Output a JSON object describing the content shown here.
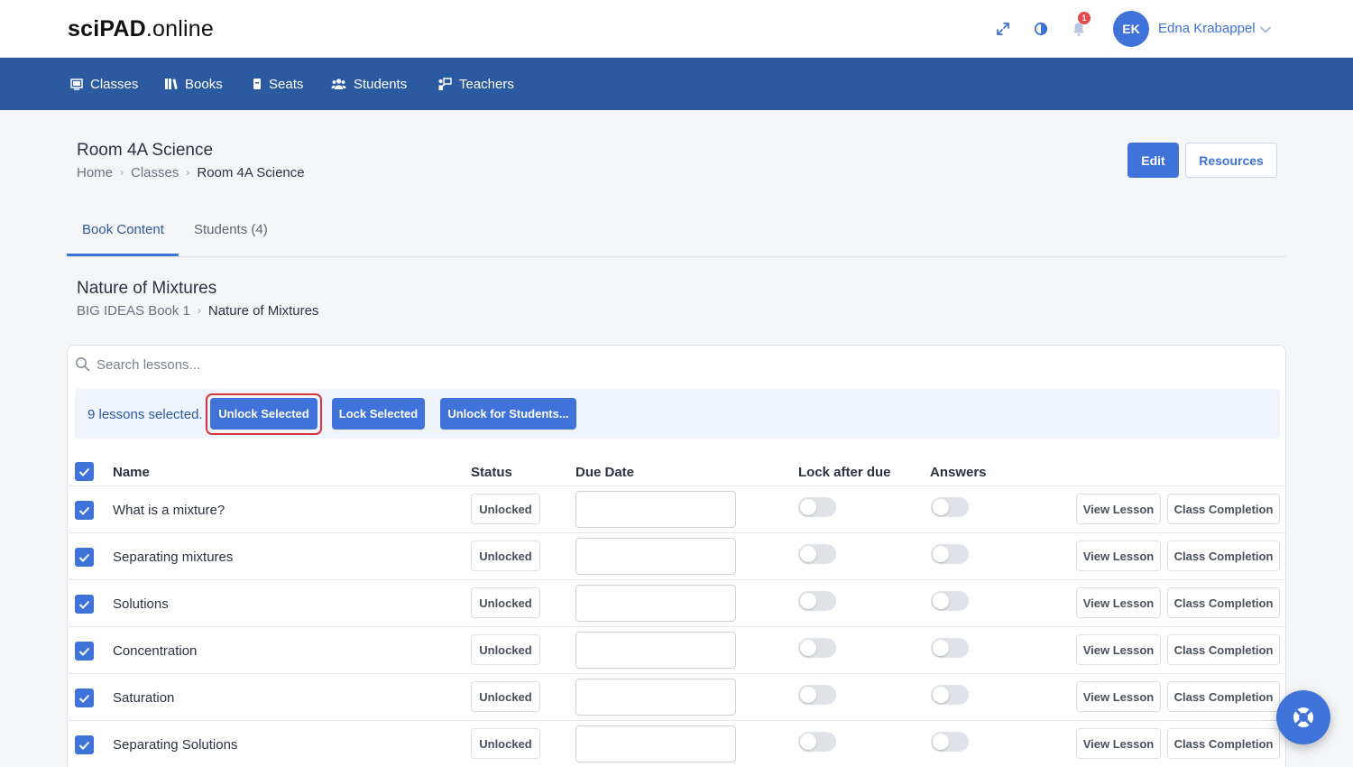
{
  "app": {
    "logo_bold": "sciPAD",
    "logo_light": ".online"
  },
  "user": {
    "initials": "EK",
    "name": "Edna Krabappel",
    "notification_count": "1"
  },
  "nav": {
    "items": [
      {
        "label": "Classes",
        "icon": "classroom-icon"
      },
      {
        "label": "Books",
        "icon": "books-icon"
      },
      {
        "label": "Seats",
        "icon": "seat-icon"
      },
      {
        "label": "Students",
        "icon": "students-icon"
      },
      {
        "label": "Teachers",
        "icon": "teachers-icon"
      }
    ]
  },
  "page": {
    "title": "Room 4A Science",
    "breadcrumb": [
      "Home",
      "Classes",
      "Room 4A Science"
    ],
    "edit_label": "Edit",
    "resources_label": "Resources"
  },
  "tabs": [
    {
      "label": "Book Content",
      "active": true
    },
    {
      "label": "Students (4)",
      "active": false
    }
  ],
  "section": {
    "title": "Nature of Mixtures",
    "breadcrumb": [
      "BIG IDEAS Book 1",
      "Nature of Mixtures"
    ]
  },
  "search": {
    "placeholder": "Search lessons..."
  },
  "selection": {
    "count_text": "9 lessons selected.",
    "unlock_label": "Unlock Selected",
    "lock_label": "Lock Selected",
    "unlock_students_label": "Unlock for Students..."
  },
  "table": {
    "headers": {
      "name": "Name",
      "status": "Status",
      "due_date": "Due Date",
      "lock_after_due": "Lock after due",
      "answers": "Answers"
    },
    "view_label": "View Lesson",
    "completion_label": "Class Completion",
    "rows": [
      {
        "name": "What is a mixture?",
        "status": "Unlocked",
        "due_date": "",
        "checked": true,
        "lock_after_due": false,
        "answers": false
      },
      {
        "name": "Separating mixtures",
        "status": "Unlocked",
        "due_date": "",
        "checked": true,
        "lock_after_due": false,
        "answers": false
      },
      {
        "name": "Solutions",
        "status": "Unlocked",
        "due_date": "",
        "checked": true,
        "lock_after_due": false,
        "answers": false
      },
      {
        "name": "Concentration",
        "status": "Unlocked",
        "due_date": "",
        "checked": true,
        "lock_after_due": false,
        "answers": false
      },
      {
        "name": "Saturation",
        "status": "Unlocked",
        "due_date": "",
        "checked": true,
        "lock_after_due": false,
        "answers": false
      },
      {
        "name": "Separating Solutions",
        "status": "Unlocked",
        "due_date": "",
        "checked": true,
        "lock_after_due": false,
        "answers": false
      }
    ]
  },
  "colors": {
    "primary": "#3f73d9",
    "navbar": "#2c5aa0",
    "highlight": "#d7363c"
  }
}
